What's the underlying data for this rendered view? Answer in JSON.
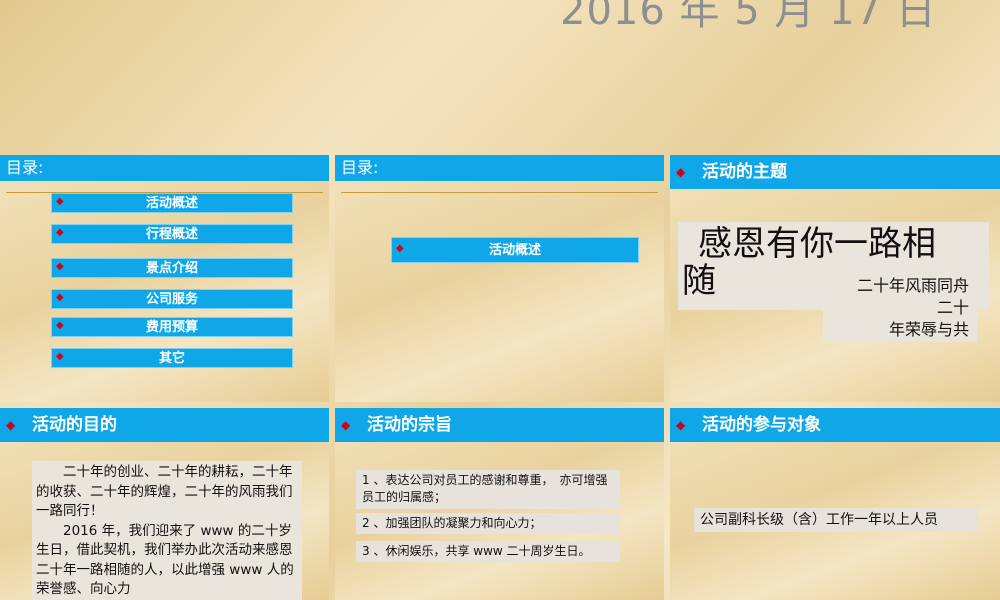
{
  "header": {
    "date": "2016 年 5 月 17 日"
  },
  "slide1": {
    "title": "目录:",
    "items": [
      "活动概述",
      "行程概述",
      "景点介绍",
      "公司服务",
      "费用预算",
      "其它"
    ]
  },
  "slide2": {
    "title": "目录:",
    "item": "活动概述"
  },
  "slide3": {
    "title": "活动的主题",
    "main_text": "感恩有你一路相随",
    "sub_line1": "二十年风雨同舟",
    "sub_line2": "二十",
    "sub_line3": "年荣辱与共"
  },
  "slide4": {
    "title": "活动的目的",
    "body": "　　二十年的创业、二十年的耕耘，二十年的收获、二十年的辉煌，二十年的风雨我们一路同行！\n　　2016 年，我们迎来了 www 的二十岁生日，借此契机，我们举办此次活动来感恩二十年一路相随的人，以此增强 www 人的荣誉感、向心力"
  },
  "slide5": {
    "title": "活动的宗旨",
    "items": [
      "1 、表达公司对员工的感谢和尊重，　亦可增强员工的归属感；",
      "2 、加强团队的凝聚力和向心力；",
      "3 、休闲娱乐，共享 www 二十周岁生日。"
    ]
  },
  "slide6": {
    "title": "活动的参与对象",
    "text": "公司副科长级（含）工作一年以上人员"
  },
  "colors": {
    "accent_blue": "#10a7e8",
    "bullet_red": "#d0021b",
    "rule_gold": "#c89b3c"
  },
  "icons": {
    "bullet": "diamond-bullet-icon"
  }
}
